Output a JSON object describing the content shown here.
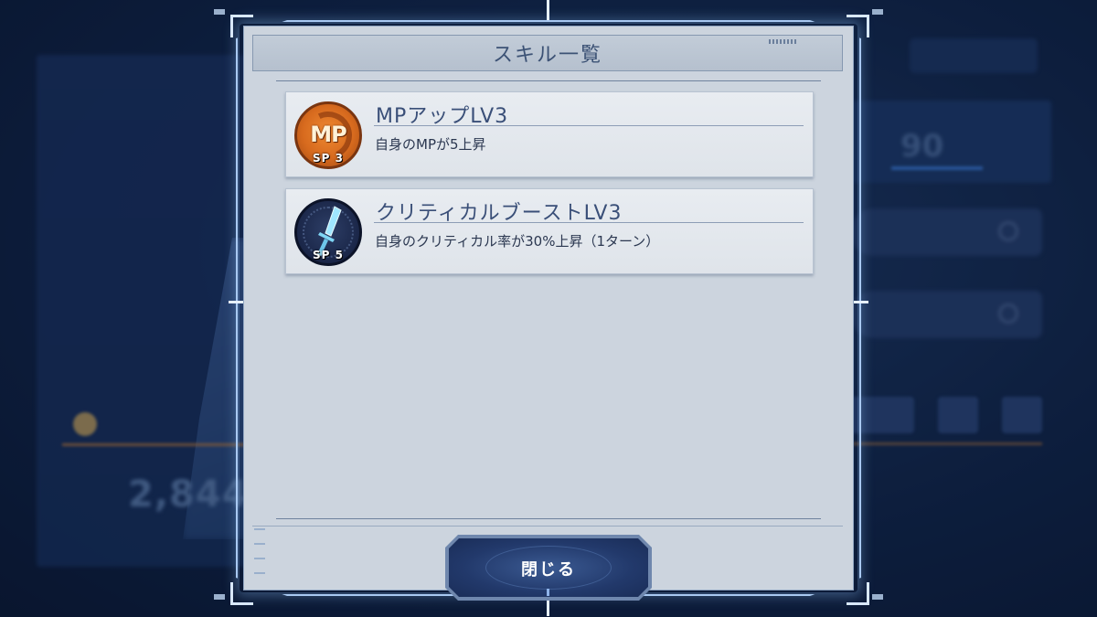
{
  "dialog": {
    "title": "スキル一覧",
    "close_label": "閉じる"
  },
  "skills": [
    {
      "name": "MPアップLV3",
      "description": "自身のMPが5上昇",
      "icon": "mp-up-icon",
      "icon_letters": "MP",
      "sp_cost": "SP 3",
      "icon_color": "#e07a28"
    },
    {
      "name": "クリティカルブーストLV3",
      "description": "自身のクリティカル率が30%上昇（1ターン）",
      "icon": "sword-icon",
      "sp_cost": "SP 5",
      "icon_color": "#1f2c50"
    }
  ],
  "background": {
    "power_value": "2,844",
    "right_value": "90"
  },
  "colors": {
    "panel": "#ccd4de",
    "title_text": "#3c5275",
    "frame_glow": "#a9c9f2",
    "button": "#22396b"
  }
}
